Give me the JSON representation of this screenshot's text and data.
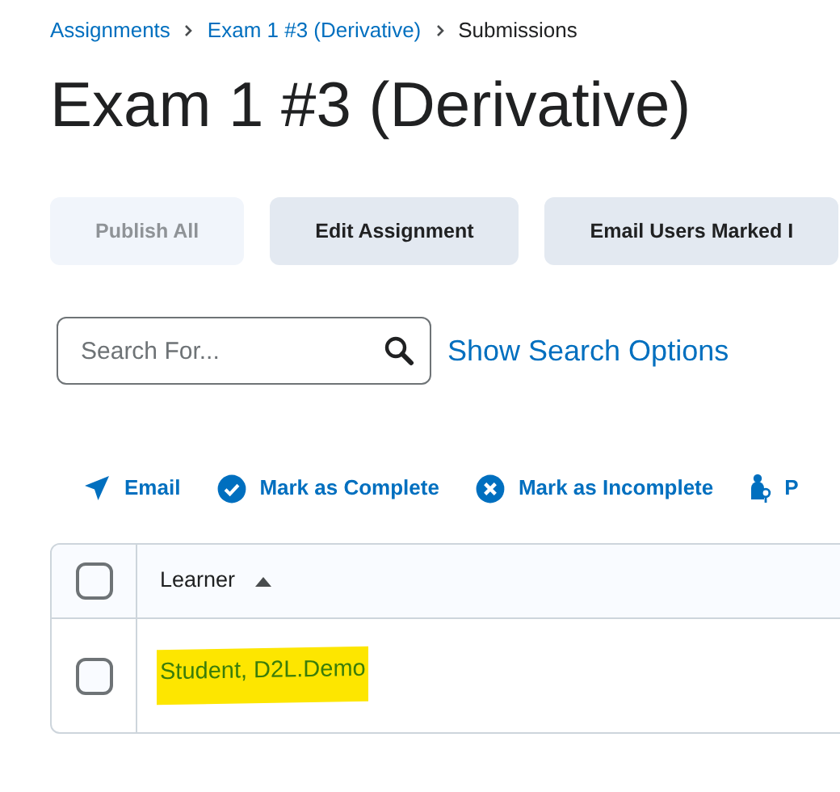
{
  "breadcrumbs": [
    {
      "label": "Assignments",
      "link": true
    },
    {
      "label": "Exam 1 #3 (Derivative)",
      "link": true
    },
    {
      "label": "Submissions",
      "link": false
    }
  ],
  "title": "Exam 1 #3 (Derivative)",
  "buttons": [
    {
      "label": "Publish All",
      "disabled": true
    },
    {
      "label": "Edit Assignment",
      "disabled": false
    },
    {
      "label": "Email Users Marked I",
      "disabled": false
    }
  ],
  "search": {
    "placeholder": "Search For..."
  },
  "search_options_link": "Show Search Options",
  "actions": [
    {
      "kind": "email",
      "label": "Email"
    },
    {
      "kind": "complete",
      "label": "Mark as Complete"
    },
    {
      "kind": "incomplete",
      "label": "Mark as Incomplete"
    },
    {
      "kind": "person",
      "label": "P"
    }
  ],
  "table": {
    "select_all": {
      "checked": false
    },
    "columns": [
      {
        "label": "Learner",
        "sorted_ascending": true
      }
    ],
    "rows": [
      {
        "learner": "Student, D2L.Demo",
        "checked": false,
        "highlighted": true
      }
    ]
  }
}
